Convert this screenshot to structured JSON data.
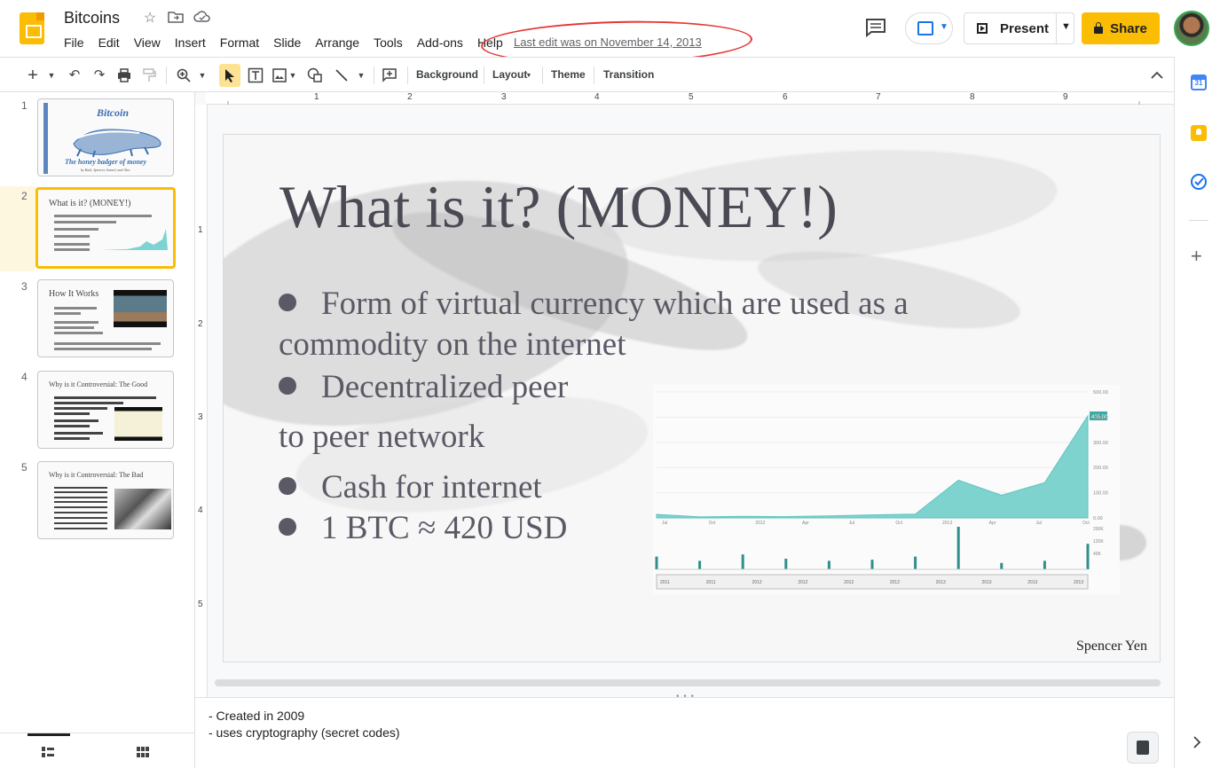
{
  "app": {
    "title": "Bitcoins",
    "last_edit": "Last edit was on November 14, 2013",
    "menu": [
      "File",
      "Edit",
      "View",
      "Insert",
      "Format",
      "Slide",
      "Arrange",
      "Tools",
      "Add-ons",
      "Help"
    ]
  },
  "header": {
    "present_label": "Present",
    "share_label": "Share"
  },
  "toolbar": {
    "background_label": "Background",
    "layout_label": "Layout",
    "theme_label": "Theme",
    "transition_label": "Transition"
  },
  "ruler": {
    "horizontal": [
      "1",
      "2",
      "3",
      "4",
      "5",
      "6",
      "7",
      "8",
      "9"
    ],
    "vertical": [
      "1",
      "2",
      "3",
      "4",
      "5"
    ]
  },
  "filmstrip": {
    "slides": [
      {
        "num": "1",
        "title": "Bitcoin",
        "subtitle": "The honey badger of money",
        "byline": "by Ruth, Spencer, Saneel, and Alex"
      },
      {
        "num": "2",
        "title": "What is it? (MONEY!)"
      },
      {
        "num": "3",
        "title": "How It Works"
      },
      {
        "num": "4",
        "title": "Why is it Controversial: The Good"
      },
      {
        "num": "5",
        "title": "Why is it Controversial: The Bad"
      }
    ]
  },
  "slide": {
    "title": "What is it? (MONEY!)",
    "bullets": [
      {
        "line1": "Form of virtual currency which are used as a",
        "line2": "commodity on the internet"
      },
      {
        "line1": "Decentralized peer",
        "line2": "to peer network"
      },
      {
        "line1": "Cash for internet"
      },
      {
        "line1": "1 BTC ≈ 420 USD"
      }
    ],
    "author": "Spencer Yen",
    "chart": {
      "price_axis": [
        "500.00",
        "400.00",
        "300.00",
        "200.00",
        "100.00",
        "0.00"
      ],
      "price_flag": "405.00",
      "month_labels": [
        "Jul",
        "Oct",
        "2012",
        "Apr",
        "Jul",
        "Oct",
        "2013",
        "Apr",
        "Jul",
        "Oct"
      ],
      "volume_axis": [
        "200K",
        "120K",
        "40K"
      ],
      "nav_years": [
        "2011",
        "2011",
        "2012",
        "2012",
        "2012",
        "2012",
        "2013",
        "2013",
        "2013",
        "2013"
      ]
    }
  },
  "chart_data": {
    "type": "area",
    "title": "",
    "xlabel": "",
    "ylabel": "",
    "ylim": [
      0,
      500
    ],
    "x": [
      "2011-07",
      "2011-10",
      "2012-01",
      "2012-04",
      "2012-07",
      "2012-10",
      "2013-01",
      "2013-04",
      "2013-07",
      "2013-10",
      "2013-11"
    ],
    "series": [
      {
        "values": [
          14,
          4,
          6,
          5,
          8,
          12,
          15,
          150,
          90,
          140,
          405
        ]
      }
    ],
    "volume_series": [
      {
        "values": [
          60,
          40,
          70,
          50,
          40,
          45,
          60,
          200,
          30,
          40,
          120
        ]
      }
    ]
  },
  "notes": {
    "lines": [
      "- Created in 2009",
      "- uses cryptography (secret codes)"
    ]
  }
}
